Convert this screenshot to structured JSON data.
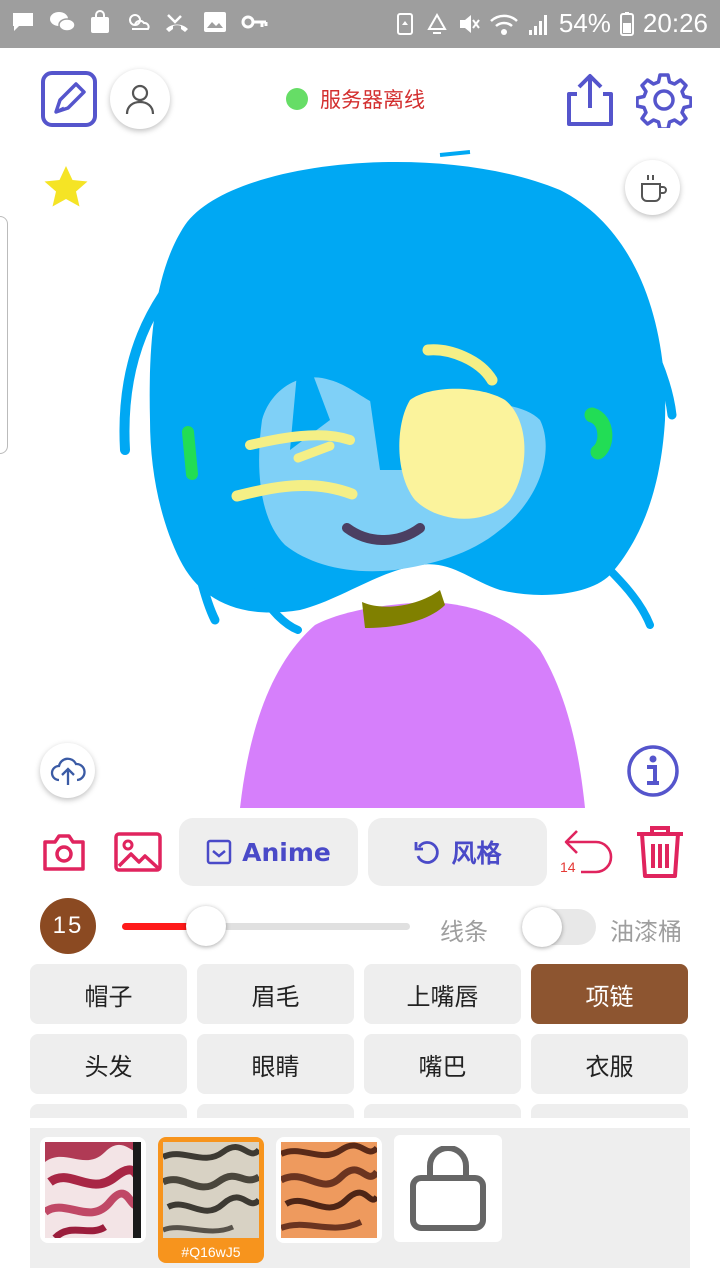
{
  "status_bar": {
    "battery": "54%",
    "time": "20:26",
    "left_icons": [
      "message-icon",
      "wechat-icon",
      "shopping-bag-icon",
      "weather-icon",
      "missed-call-icon",
      "image-icon",
      "key-icon"
    ],
    "right_icons": [
      "recycle-icon",
      "recycle-alt-icon",
      "mute-icon",
      "wifi-icon",
      "signal-icon",
      "battery-icon"
    ]
  },
  "header": {
    "server_status_label": "服务器离线",
    "server_status_color": "#66dd66"
  },
  "toolbar": {
    "style_button_label": "Anime",
    "style_switch_label": "风格",
    "undo_count": "14"
  },
  "brush": {
    "size": "15",
    "slider_level": 0.29,
    "line_label": "线条",
    "bucket_label": "油漆桶",
    "bucket_enabled": false,
    "line_color": "#ff1a1a"
  },
  "parts": {
    "items": [
      "帽子",
      "眉毛",
      "上嘴唇",
      "项链",
      "头发",
      "眼睛",
      "嘴巴",
      "衣服"
    ],
    "active": "项链",
    "active_color": "#8d5530"
  },
  "styles": {
    "selected_code": "#Q16wJ5",
    "selected_color": "#f7941d"
  },
  "colors": {
    "accent": "#4a4ac8",
    "danger": "#e0245e",
    "hair": "#00a8f3",
    "skin": "#7fd0f7",
    "shirt": "#d67ffb"
  }
}
